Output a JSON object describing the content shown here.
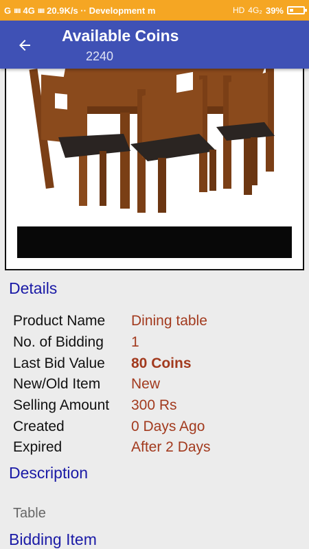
{
  "status_bar": {
    "left_text": "20.9K/s ·· Development m",
    "carrier_g": "G",
    "network": "4G",
    "right_hd": "HD",
    "right_net": "4G₂",
    "battery": "39%"
  },
  "app_bar": {
    "title": "Available Coins",
    "subtitle": "2240"
  },
  "details": {
    "heading": "Details",
    "rows": [
      {
        "label": "Product Name",
        "value": "Dining table"
      },
      {
        "label": "No. of Bidding",
        "value": "1"
      },
      {
        "label": "Last Bid Value",
        "value": "80 Coins"
      },
      {
        "label": "New/Old Item",
        "value": "New"
      },
      {
        "label": "Selling Amount",
        "value": "300 Rs"
      },
      {
        "label": "Created",
        "value": "0 Days Ago"
      },
      {
        "label": "Expired",
        "value": "After 2 Days"
      }
    ]
  },
  "description": {
    "heading": "Description",
    "text": "Table"
  },
  "bidding": {
    "heading": "Bidding Item"
  },
  "colors": {
    "status_bar": "#f5a623",
    "app_bar": "#3f51b5",
    "heading_blue": "#1a1aa6",
    "value_red": "#a23a1e"
  }
}
